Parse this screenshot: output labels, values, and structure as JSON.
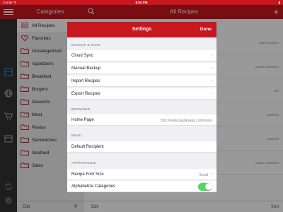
{
  "statusbar": {
    "carrier": "Carrier ᯤ",
    "time": "8:54 PM",
    "battery": "▮"
  },
  "navbar": {
    "categories_title": "Categories",
    "all_recipes_title": "All Recipes",
    "add": "+"
  },
  "sidebar": {
    "items": [
      {
        "label": "All Recipes",
        "icon": "list-icon"
      },
      {
        "label": "Favorites",
        "icon": "heart-icon"
      },
      {
        "label": "Uncategorized",
        "icon": "folder-icon"
      },
      {
        "label": "Appetizers",
        "icon": "folder-icon"
      },
      {
        "label": "Breakfast",
        "icon": "folder-icon"
      },
      {
        "label": "Burgers",
        "icon": "folder-icon"
      },
      {
        "label": "Desserts",
        "icon": "folder-icon"
      },
      {
        "label": "Meat",
        "icon": "folder-icon"
      },
      {
        "label": "Pastas",
        "icon": "folder-icon"
      },
      {
        "label": "Sandwiches",
        "icon": "folder-icon"
      },
      {
        "label": "Seafood",
        "icon": "folder-icon"
      },
      {
        "label": "Sides",
        "icon": "folder-icon"
      }
    ],
    "edit_label": "Edit",
    "add_label": "+"
  },
  "recipe_list": {
    "tags": [
      "Beef, Burgers",
      "Cakes, Desserts",
      "Pie",
      "Seafood",
      "Seafood",
      "Cakes, Desserts"
    ],
    "edit_label": "Edit",
    "sort_label": "Sort"
  },
  "settings": {
    "title": "Settings",
    "done_label": "Done",
    "sections": {
      "backup_sync": "BACKUP & SYNC",
      "browser": "BROWSER",
      "email": "EMAIL",
      "appearance": "APPEARANCE"
    },
    "cloud_sync": "Cloud Sync",
    "manual_backup": "Manual Backup",
    "import_recipes": "Import Recipes",
    "export_recipes": "Export Recipes",
    "home_page_label": "Home Page",
    "home_page_value": "http://www.paprikaapp.com/sites/",
    "default_recipient": "Default Recipient",
    "font_size_label": "Recipe Font Size",
    "font_size_value": "Small",
    "alphabetize_label": "Alphabetize Categories",
    "alphabetize_on": true
  },
  "colors": {
    "brand_red": "#c8171e",
    "toggle_green": "#4cd964",
    "rail": "#333333"
  }
}
